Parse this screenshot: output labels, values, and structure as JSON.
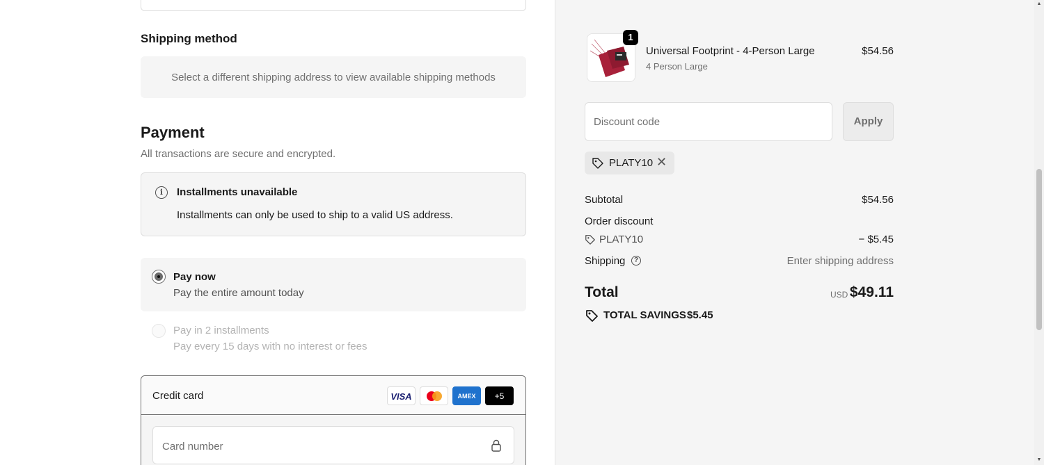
{
  "shipping": {
    "title": "Shipping method",
    "message": "Select a different shipping address to view available shipping methods"
  },
  "payment": {
    "title": "Payment",
    "subtitle": "All transactions are secure and encrypted.",
    "notice": {
      "title": "Installments unavailable",
      "text": "Installments can only be used to ship to a valid US address."
    },
    "options": [
      {
        "title": "Pay now",
        "subtitle": "Pay the entire amount today",
        "selected": true
      },
      {
        "title": "Pay in 2 installments",
        "subtitle": "Pay every 15 days with no interest or fees",
        "selected": false
      }
    ],
    "credit_card": {
      "label": "Credit card",
      "logos": {
        "visa": "VISA",
        "amex": "AMEX",
        "more": "+5"
      },
      "card_number_placeholder": "Card number"
    }
  },
  "order": {
    "item": {
      "quantity": "1",
      "name": "Universal Footprint - 4-Person Large",
      "variant": "4 Person Large",
      "price": "$54.56"
    },
    "discount": {
      "placeholder": "Discount code",
      "apply_label": "Apply",
      "applied_code": "PLATY10"
    },
    "summary": {
      "subtotal_label": "Subtotal",
      "subtotal_value": "$54.56",
      "order_discount_label": "Order discount",
      "discount_code": "PLATY10",
      "discount_value": "− $5.45",
      "shipping_label": "Shipping",
      "shipping_value": "Enter shipping address",
      "total_label": "Total",
      "currency": "USD",
      "total_value": "$49.11",
      "savings_label": "TOTAL SAVINGS",
      "savings_value": "$5.45"
    }
  },
  "colors": {
    "panel_bg": "#f5f5f5",
    "product_red": "#a8213a"
  }
}
